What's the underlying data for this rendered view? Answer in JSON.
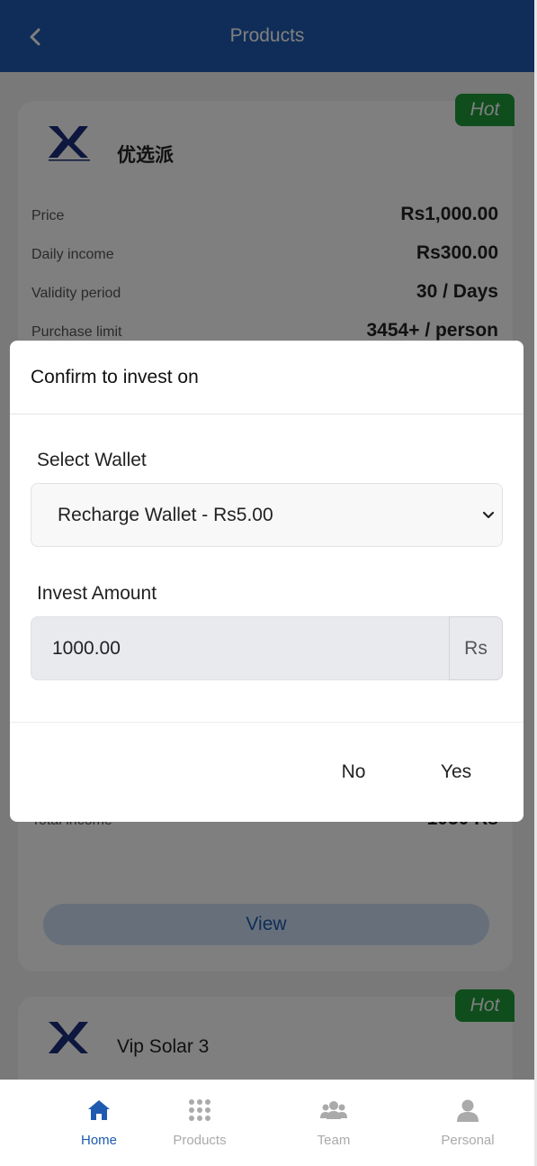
{
  "header": {
    "title": "Products"
  },
  "cards": [
    {
      "badge": "Hot",
      "name": "优选派",
      "rows": [
        {
          "label": "Price",
          "value": "Rs1,000.00"
        },
        {
          "label": "Daily income",
          "value": "Rs300.00"
        },
        {
          "label": "Validity period",
          "value": "30 / Days"
        },
        {
          "label": "Purchase limit",
          "value": "3454+ / person"
        },
        {
          "label": "Total income",
          "value": "1050 Rs"
        }
      ],
      "view_label": "View"
    },
    {
      "badge": "Hot",
      "name": "Vip Solar 3"
    }
  ],
  "modal": {
    "title": "Confirm to invest on ",
    "wallet_label": "Select Wallet",
    "wallet_selected": "Recharge Wallet - Rs5.00",
    "amount_label": "Invest Amount",
    "amount_value": "1000.00",
    "currency": "Rs",
    "no_label": "No",
    "yes_label": "Yes"
  },
  "nav": [
    {
      "label": "Home",
      "icon": "home-icon",
      "active": true
    },
    {
      "label": "Products",
      "icon": "grid-icon",
      "active": false
    },
    {
      "label": "Team",
      "icon": "team-icon",
      "active": false
    },
    {
      "label": "Personal",
      "icon": "person-icon",
      "active": false
    }
  ],
  "colors": {
    "primary": "#1e5bb0",
    "hot": "#1f9a3a",
    "logo": "#1a2d7a"
  }
}
